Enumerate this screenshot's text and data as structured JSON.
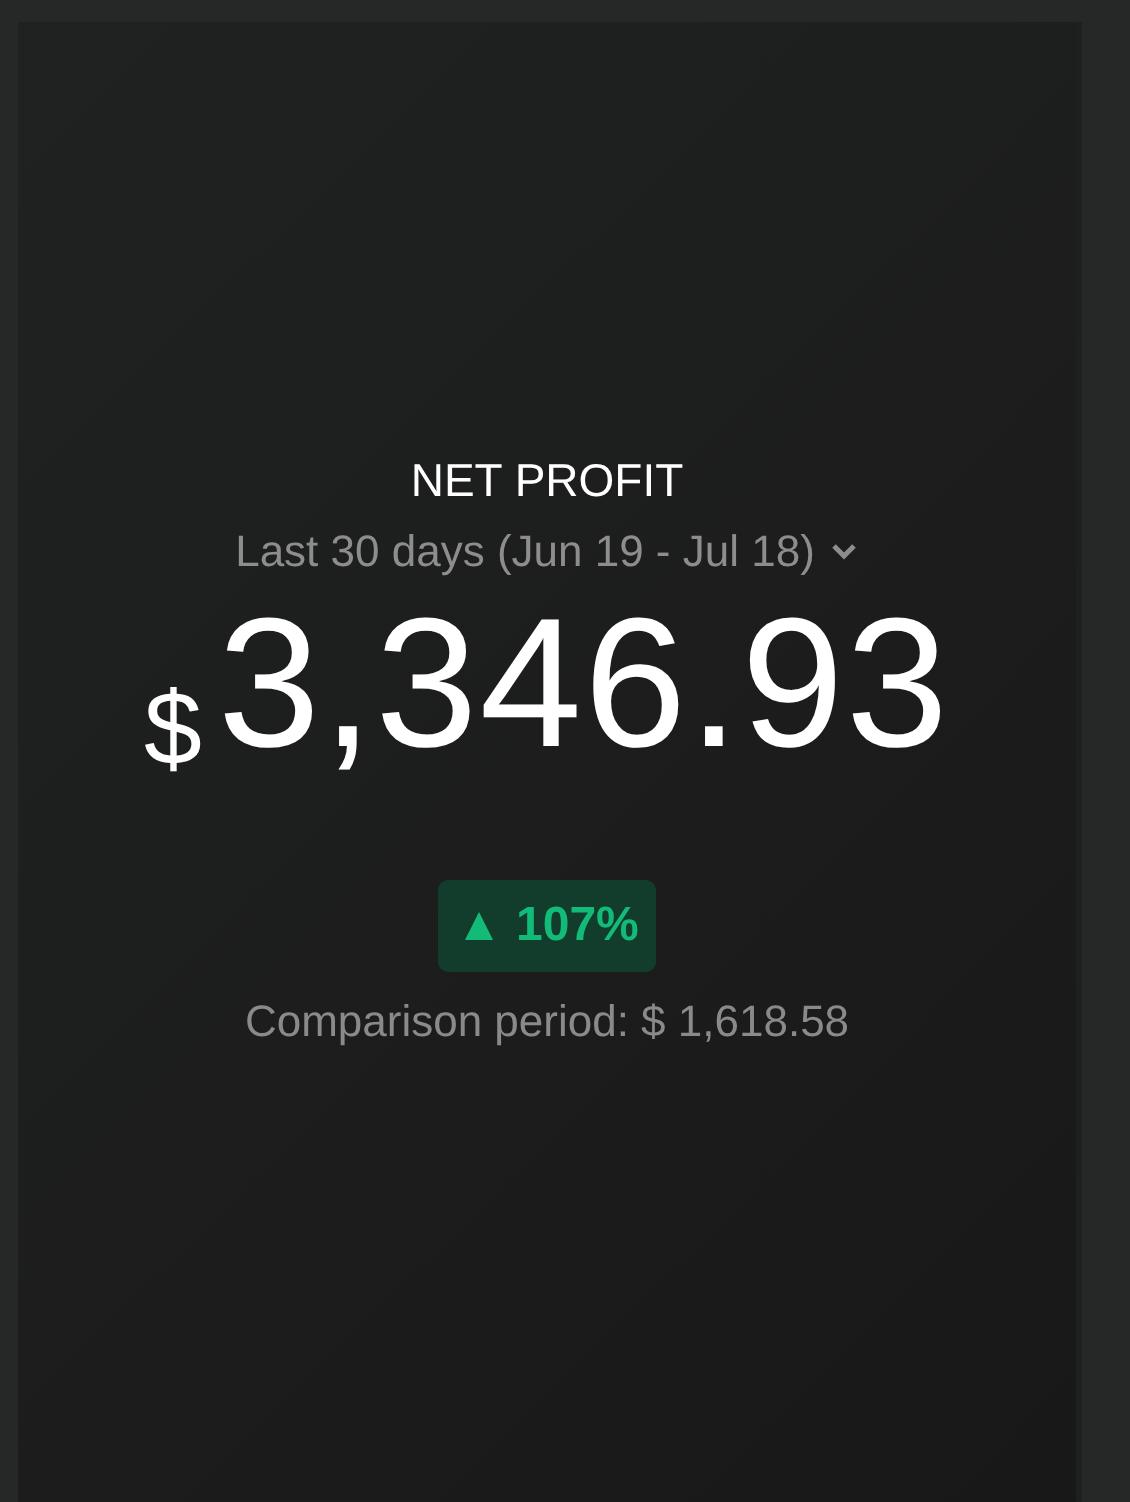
{
  "card": {
    "title": "NET PROFIT",
    "period": "Last 30 days (Jun 19 - Jul 18)",
    "currency": "$",
    "amount": "3,346.93",
    "change": {
      "arrow": "▲",
      "value": "107%"
    },
    "comparison": "Comparison period: $ 1,618.58"
  }
}
